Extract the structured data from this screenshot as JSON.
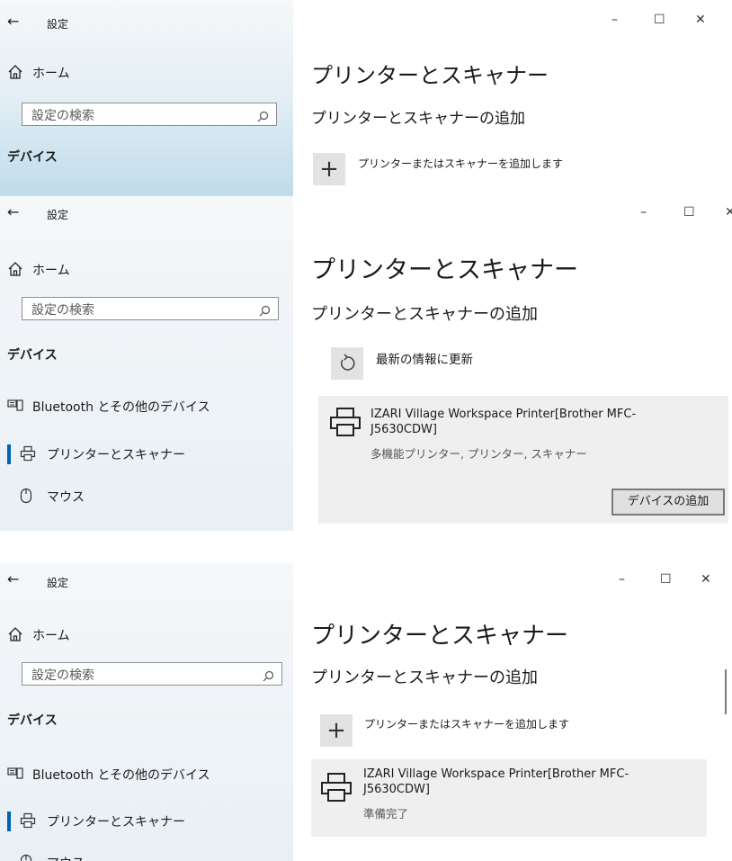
{
  "panel1": {
    "back_label": "←",
    "window_title": "設定",
    "home_label": "ホーム",
    "search_placeholder": "設定の検索",
    "section_label": "デバイス",
    "page_title": "プリンターとスキャナー",
    "add_heading": "プリンターとスキャナーの追加",
    "add_button_label": "プリンターまたはスキャナーを追加します",
    "window_controls": {
      "minimize": "–",
      "maximize": "☐",
      "close": "✕"
    }
  },
  "panel2": {
    "back_label": "←",
    "window_title": "設定",
    "home_label": "ホーム",
    "search_placeholder": "設定の検索",
    "section_label": "デバイス",
    "nav_items": [
      {
        "label": "Bluetooth とその他のデバイス",
        "icon": "keyboard-icon"
      },
      {
        "label": "プリンターとスキャナー",
        "icon": "printer-icon",
        "selected": true
      },
      {
        "label": "マウス",
        "icon": "mouse-icon"
      }
    ],
    "page_title": "プリンターとスキャナー",
    "add_heading": "プリンターとスキャナーの追加",
    "refresh_label": "最新の情報に更新",
    "device": {
      "name": "IZARI Village Workspace Printer[Brother MFC-J5630CDW]",
      "status": "多機能プリンター, プリンター, スキャナー"
    },
    "add_device_button": "デバイスの追加",
    "window_controls": {
      "minimize": "–",
      "maximize": "☐",
      "close": "✕"
    }
  },
  "panel3": {
    "back_label": "←",
    "window_title": "設定",
    "home_label": "ホーム",
    "search_placeholder": "設定の検索",
    "section_label": "デバイス",
    "nav_items": [
      {
        "label": "Bluetooth とその他のデバイス",
        "icon": "keyboard-icon"
      },
      {
        "label": "プリンターとスキャナー",
        "icon": "printer-icon",
        "selected": true
      },
      {
        "label": "マウス",
        "icon": "mouse-icon"
      }
    ],
    "page_title": "プリンターとスキャナー",
    "add_heading": "プリンターとスキャナーの追加",
    "add_button_label": "プリンターまたはスキャナーを追加します",
    "device": {
      "name": "IZARI Village Workspace Printer[Brother MFC-J5630CDW]",
      "status": "準備完了"
    },
    "window_controls": {
      "minimize": "–",
      "maximize": "☐",
      "close": "✕"
    }
  },
  "colors": {
    "accent": "#0063b1",
    "sidebar_tint": "#bfdcea",
    "card": "#efefef",
    "tile": "#e2e2e2"
  }
}
